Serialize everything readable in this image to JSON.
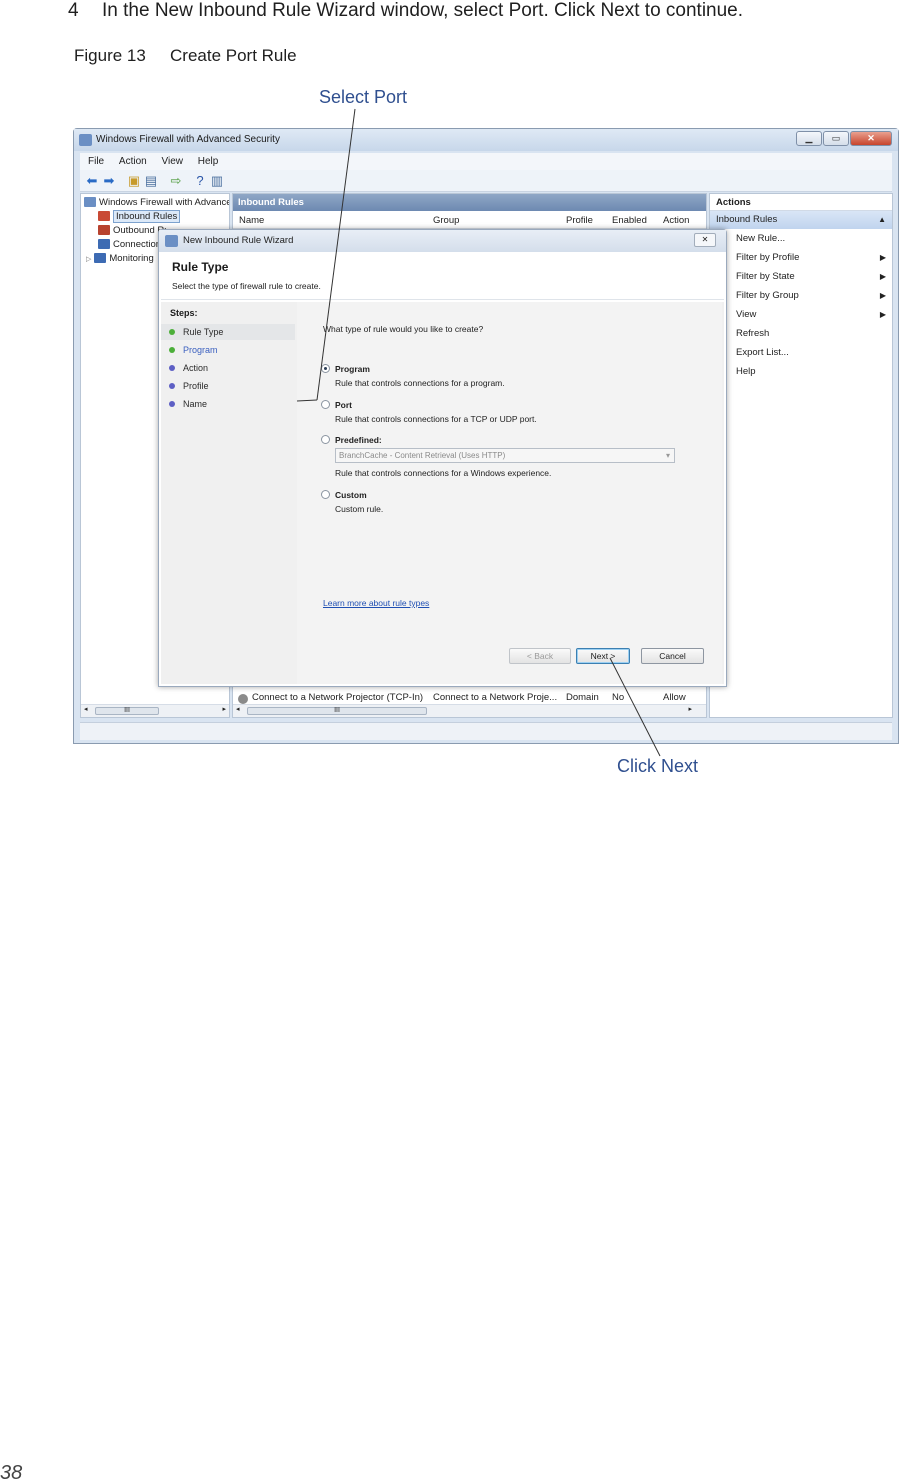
{
  "doc": {
    "step_number": "4",
    "step_text": "In the New Inbound Rule Wizard window, select Port. Click Next to continue.",
    "figure_label": "Figure 13",
    "figure_title": "Create Port Rule",
    "callout_port": "Select Port",
    "callout_next": "Click Next",
    "page_number": "38"
  },
  "mmc": {
    "title": "Windows Firewall with Advanced Security",
    "menu": [
      "File",
      "Action",
      "View",
      "Help"
    ],
    "tree": [
      "Windows Firewall with Advanced",
      "Inbound Rules",
      "Outbound Rules",
      "Connection",
      "Monitoring"
    ],
    "center_header": "Inbound Rules",
    "columns": [
      "Name",
      "Group",
      "Profile",
      "Enabled",
      "Action"
    ],
    "visible_row": {
      "name": "Connect to a Network Projector (TCP-In)",
      "group": "Connect to a Network Proje...",
      "profile": "Domain",
      "enabled": "No",
      "action": "Allow"
    },
    "actions_header": "Actions",
    "actions_sub": "Inbound Rules",
    "actions": [
      {
        "label": "New Rule...",
        "arrow": ""
      },
      {
        "label": "Filter by Profile",
        "arrow": "▶"
      },
      {
        "label": "Filter by State",
        "arrow": "▶"
      },
      {
        "label": "Filter by Group",
        "arrow": "▶"
      },
      {
        "label": "View",
        "arrow": "▶"
      },
      {
        "label": "Refresh",
        "arrow": ""
      },
      {
        "label": "Export List...",
        "arrow": ""
      },
      {
        "label": "Help",
        "arrow": ""
      }
    ],
    "scroll_glyph": "III"
  },
  "wizard": {
    "title": "New Inbound Rule Wizard",
    "heading": "Rule Type",
    "subheading": "Select the type of firewall rule to create.",
    "steps_title": "Steps:",
    "steps": [
      "Rule Type",
      "Program",
      "Action",
      "Profile",
      "Name"
    ],
    "question": "What type of rule would you like to create?",
    "options": [
      {
        "title": "Program",
        "desc": "Rule that controls connections for a program."
      },
      {
        "title": "Port",
        "desc": "Rule that controls connections for a TCP or UDP port."
      },
      {
        "title": "Predefined:",
        "desc": "Rule that controls connections for a Windows experience."
      },
      {
        "title": "Custom",
        "desc": "Custom rule."
      }
    ],
    "selected_option": "Program",
    "predefined_value": "BranchCache - Content Retrieval (Uses HTTP)",
    "learn_link": "Learn more about rule types",
    "back_label": "< Back",
    "next_label": "Next >",
    "cancel_label": "Cancel"
  },
  "colors": {
    "callout": "#2f4f8f",
    "step_done": "#4caf3a",
    "step_pending": "#5d5fc4"
  }
}
